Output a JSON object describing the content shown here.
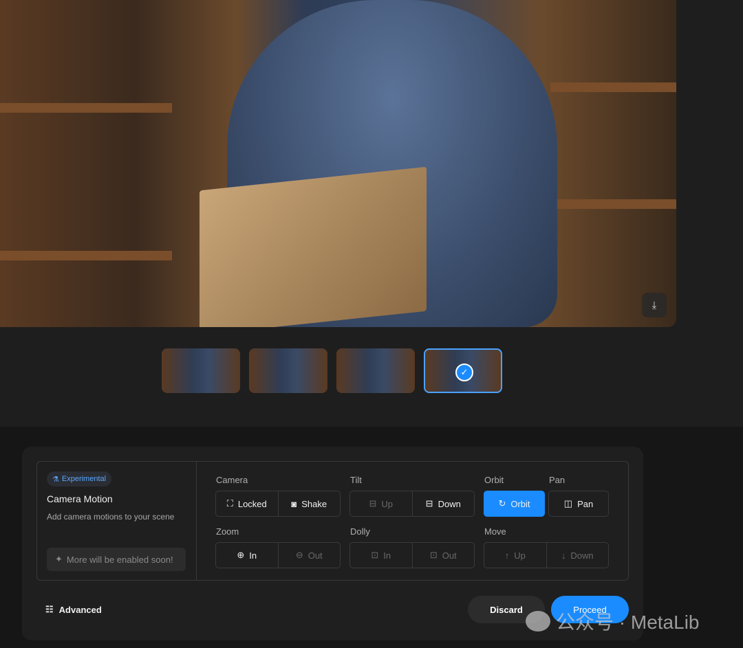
{
  "preview": {
    "download_icon": "download-icon",
    "image_alt": "Blue cat reading a book in a library"
  },
  "thumbnails": [
    {
      "selected": false
    },
    {
      "selected": false
    },
    {
      "selected": false
    },
    {
      "selected": true
    }
  ],
  "panel": {
    "badge": "Experimental",
    "title": "Camera Motion",
    "subtitle": "Add camera motions to your scene",
    "soon": "More will be enabled soon!",
    "groups": {
      "camera": {
        "label": "Camera",
        "options": [
          {
            "label": "Locked",
            "icon": "frame-corners-icon",
            "enabled": true
          },
          {
            "label": "Shake",
            "icon": "camera-shake-icon",
            "enabled": true
          }
        ]
      },
      "tilt": {
        "label": "Tilt",
        "options": [
          {
            "label": "Up",
            "icon": "tilt-up-icon",
            "enabled": false
          },
          {
            "label": "Down",
            "icon": "tilt-down-icon",
            "enabled": true
          }
        ]
      },
      "orbit": {
        "label": "Orbit",
        "options": [
          {
            "label": "Orbit",
            "icon": "orbit-icon",
            "enabled": true,
            "selected": true
          }
        ]
      },
      "pan": {
        "label": "Pan",
        "options": [
          {
            "label": "Pan",
            "icon": "pan-icon",
            "enabled": true
          }
        ]
      },
      "zoom": {
        "label": "Zoom",
        "options": [
          {
            "label": "In",
            "icon": "zoom-in-icon",
            "enabled": true
          },
          {
            "label": "Out",
            "icon": "zoom-out-icon",
            "enabled": false
          }
        ]
      },
      "dolly": {
        "label": "Dolly",
        "options": [
          {
            "label": "In",
            "icon": "dolly-in-icon",
            "enabled": false
          },
          {
            "label": "Out",
            "icon": "dolly-out-icon",
            "enabled": false
          }
        ]
      },
      "move": {
        "label": "Move",
        "options": [
          {
            "label": "Up",
            "icon": "arrow-up-icon",
            "enabled": false
          },
          {
            "label": "Down",
            "icon": "arrow-down-icon",
            "enabled": false
          }
        ]
      }
    },
    "advanced": "Advanced",
    "discard": "Discard",
    "proceed": "Proceed"
  },
  "watermark": "公众号 · MetaLib",
  "colors": {
    "accent": "#1a8cff",
    "background": "#1e1e1e"
  }
}
